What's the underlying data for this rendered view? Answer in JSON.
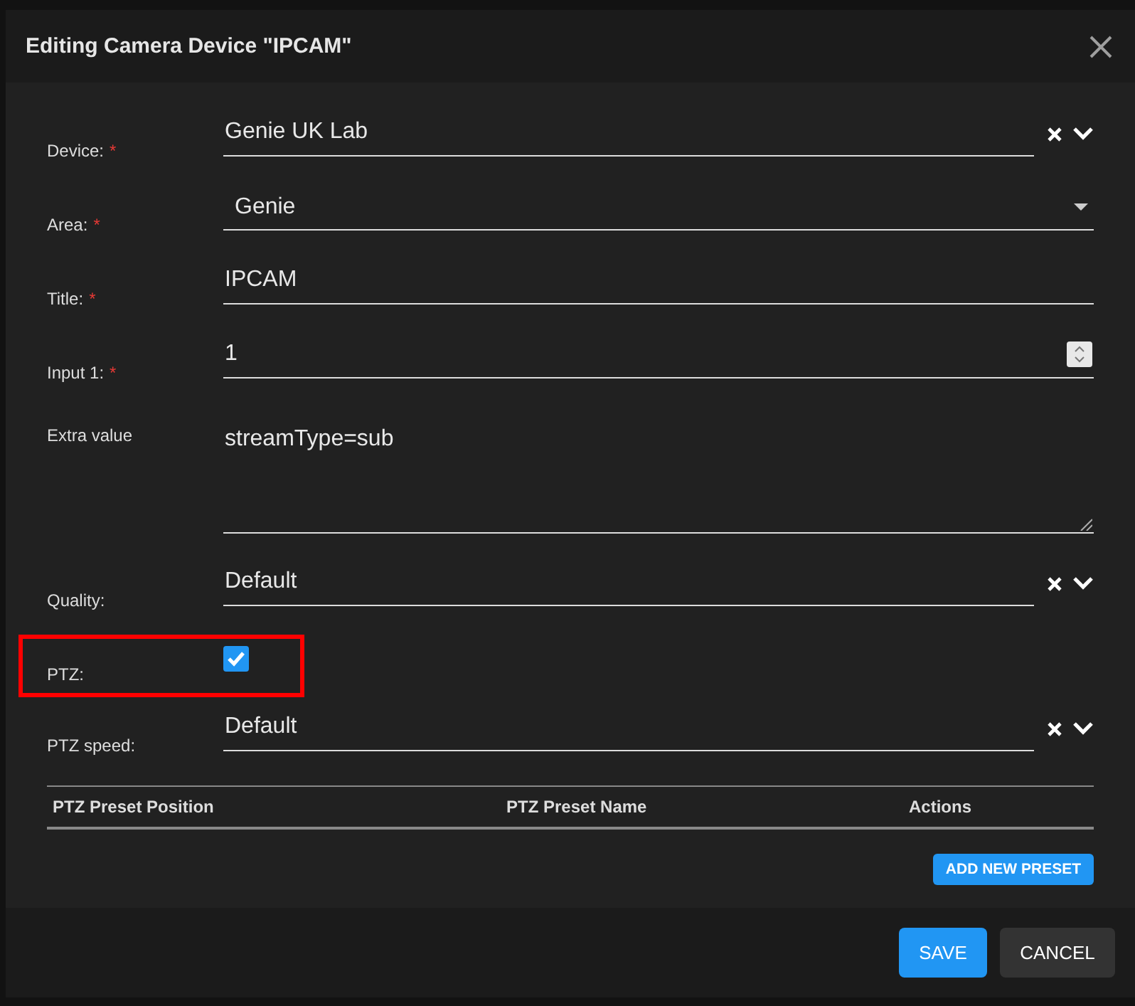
{
  "dialog": {
    "title": "Editing Camera Device \"IPCAM\""
  },
  "fields": [
    {
      "kind": "select",
      "label": "Device:",
      "required_mark": "*",
      "value": "Genie UK Lab"
    },
    {
      "kind": "dropdown",
      "label": "Area:",
      "required_mark": "*",
      "value": "Genie"
    },
    {
      "kind": "text",
      "label": "Title:",
      "required_mark": "*",
      "value": "IPCAM"
    },
    {
      "kind": "number",
      "label": "Input 1:",
      "required_mark": "*",
      "value": "1"
    },
    {
      "kind": "textarea",
      "label": "Extra value",
      "value": "streamType=sub"
    },
    {
      "kind": "select",
      "label": "Quality:",
      "value": "Default"
    },
    {
      "kind": "checkbox",
      "label": "PTZ:",
      "checked": true,
      "highlighted": true
    },
    {
      "kind": "select",
      "label": "PTZ speed:",
      "value": "Default"
    }
  ],
  "presets_table": {
    "columns": [
      "PTZ Preset Position",
      "PTZ Preset Name",
      "Actions"
    ],
    "add_button": "ADD NEW PRESET"
  },
  "buttons": [
    {
      "label": "SAVE",
      "kind": "primary"
    },
    {
      "label": "CANCEL",
      "kind": "secondary"
    }
  ]
}
